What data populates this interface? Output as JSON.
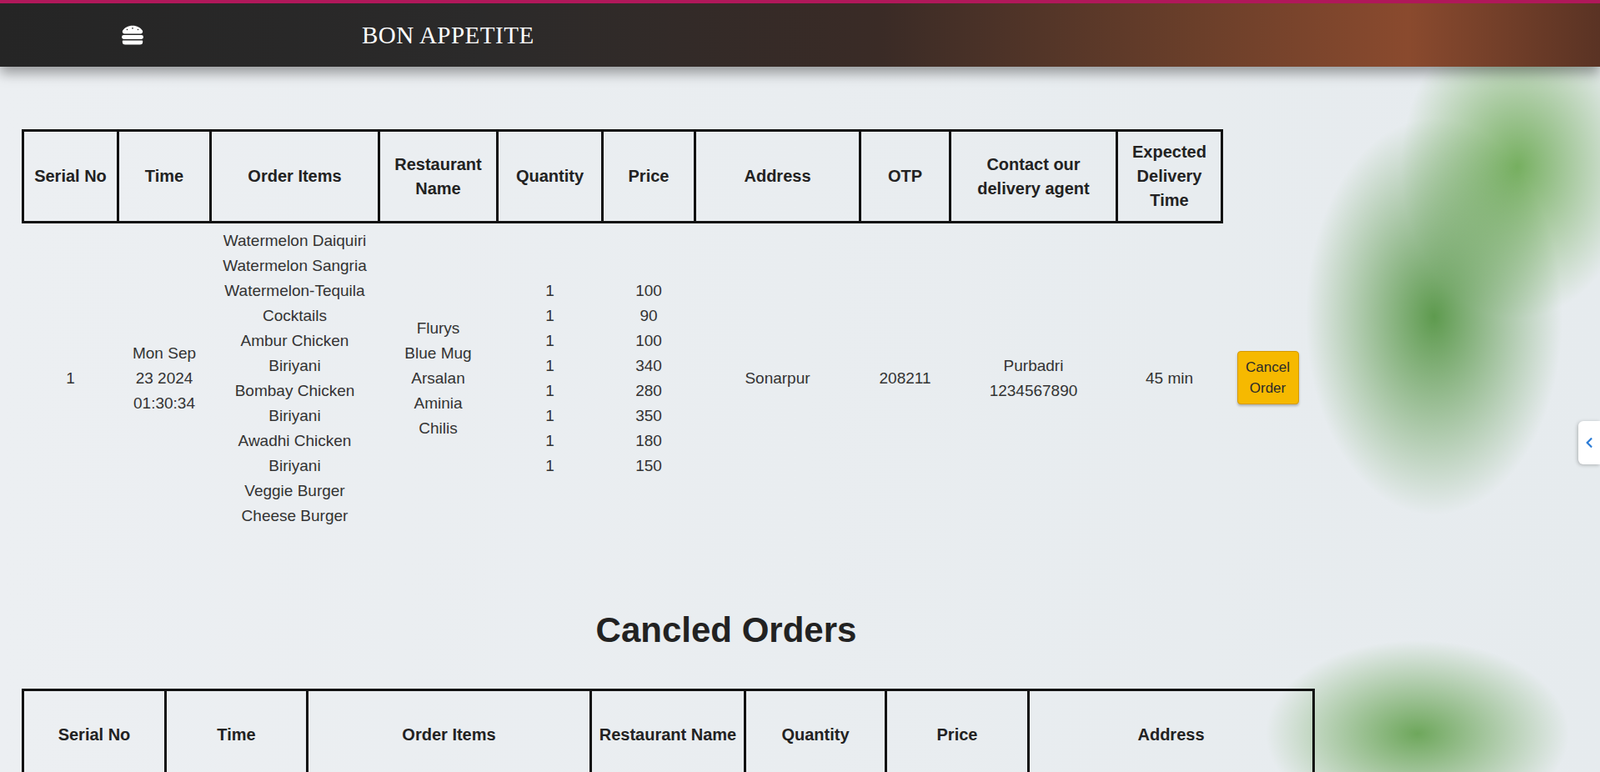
{
  "header": {
    "title": "BON APPETITE"
  },
  "orders": {
    "columns": [
      "Serial No",
      "Time",
      "Order Items",
      "Restaurant Name",
      "Quantity",
      "Price",
      "Address",
      "OTP",
      "Contact our delivery agent",
      "Expected Delivery Time"
    ],
    "rows": [
      {
        "serial": "1",
        "time": "Mon Sep 23 2024 01:30:34",
        "items": [
          "Watermelon Daiquiri",
          "Watermelon Sangria",
          "Watermelon-Tequila Cocktails",
          "Ambur Chicken Biriyani",
          "Bombay Chicken Biriyani",
          "Awadhi Chicken Biriyani",
          "Veggie Burger",
          "Cheese Burger"
        ],
        "restaurants": [
          "Flurys",
          "Blue Mug",
          "Arsalan",
          "Aminia",
          "Chilis"
        ],
        "quantities": [
          "1",
          "1",
          "1",
          "1",
          "1",
          "1",
          "1",
          "1"
        ],
        "prices": [
          "100",
          "90",
          "100",
          "340",
          "280",
          "350",
          "180",
          "150"
        ],
        "address": "Sonarpur",
        "otp": "208211",
        "agent_name": "Purbadri",
        "agent_phone": "1234567890",
        "eta": "45 min",
        "action": "Cancel Order"
      }
    ]
  },
  "canceled": {
    "title": "Cancled Orders",
    "columns": [
      "Serial No",
      "Time",
      "Order Items",
      "Restaurant Name",
      "Quantity",
      "Price",
      "Address"
    ]
  }
}
